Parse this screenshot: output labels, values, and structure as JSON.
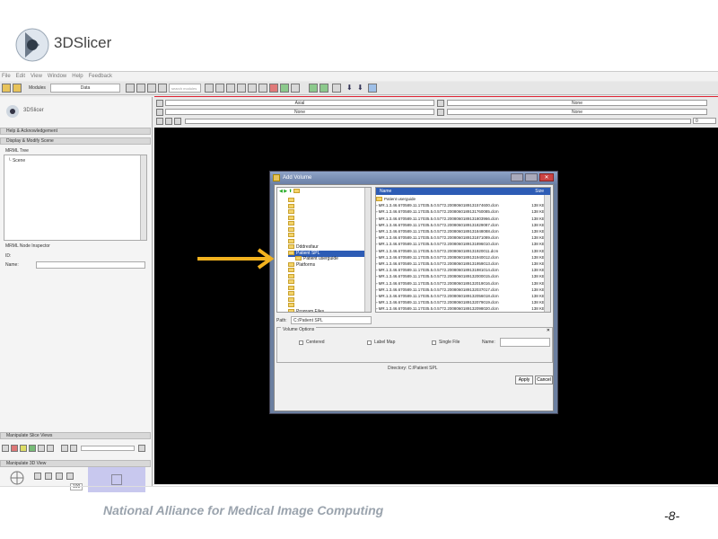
{
  "logo": {
    "text": "3DSlicer"
  },
  "menubar": {
    "items": [
      "File",
      "Edit",
      "View",
      "Window",
      "Help",
      "Feedback"
    ]
  },
  "toolbar": {
    "modules_label": "Modules",
    "modules_value": "Data",
    "search_placeholder": "search modules"
  },
  "left_panel": {
    "logo_text": "3DSlicer",
    "help_header": "Help & Acknowledgement",
    "display_header": "Display & Modify Scene",
    "mrml_tree_label": "MRML Tree",
    "scene_item": "Scene",
    "inspector_label": "MRML Node Inspector",
    "id_label": "ID:",
    "name_label": "Name:",
    "manipulate_slice_header": "Manipulate Slice Views",
    "manipulate_3d_header": "Manipulate 3D View",
    "zoom_value": "100"
  },
  "view_header": {
    "axial": "Axial",
    "none_left": "None",
    "none_right_1": "None",
    "none_right_2": "None",
    "slice_value": "0"
  },
  "dialog": {
    "title": "Add Volume",
    "tree": [
      "",
      "",
      "",
      "",
      "",
      "",
      "",
      "",
      "Dddresfaur",
      "Patient SPL",
      "Patient userguide",
      "Platforms",
      "",
      "",
      "",
      "",
      "",
      "",
      "",
      "Program Files"
    ],
    "selected_index": 9,
    "list_header_name": "Name",
    "list_header_size": "Size",
    "files": [
      {
        "name": "Patient userguide",
        "size": ""
      },
      {
        "name": "MR.1.3.46.670589.11.17035.5.0.5772.2008060189131574600.dcm",
        "size": "138 KB"
      },
      {
        "name": "MR.1.3.46.670589.11.17035.5.0.5772.2008060189131760085.dcm",
        "size": "138 KB"
      },
      {
        "name": "MR.1.3.46.670589.11.17035.5.0.5772.2008060189131803966.dcm",
        "size": "138 KB"
      },
      {
        "name": "MR.1.3.46.670589.11.17035.5.0.5772.2008060189131829087.dcm",
        "size": "138 KB"
      },
      {
        "name": "MR.1.3.46.670589.11.17035.5.0.5772.2008060189131848088.dcm",
        "size": "138 KB"
      },
      {
        "name": "MR.1.3.46.670589.11.17035.5.0.5772.2008060189131871089.dcm",
        "size": "138 KB"
      },
      {
        "name": "MR.1.3.46.670589.11.17035.5.0.5772.2008060189131896010.dcm",
        "size": "138 KB"
      },
      {
        "name": "MR.1.3.46.670589.11.17035.5.0.5772.2008060189131920011.dcm",
        "size": "138 KB"
      },
      {
        "name": "MR.1.3.46.670589.11.17035.5.0.5772.2008060189131940012.dcm",
        "size": "138 KB"
      },
      {
        "name": "MR.1.3.46.670589.11.17035.5.0.5772.2008060189131959013.dcm",
        "size": "138 KB"
      },
      {
        "name": "MR.1.3.46.670589.11.17035.5.0.5772.2008060189131981014.dcm",
        "size": "138 KB"
      },
      {
        "name": "MR.1.3.46.670589.11.17035.5.0.5772.2008060189132000015.dcm",
        "size": "138 KB"
      },
      {
        "name": "MR.1.3.46.670589.11.17035.5.0.5772.2008060189132019016.dcm",
        "size": "138 KB"
      },
      {
        "name": "MR.1.3.46.670589.11.17035.5.0.5772.2008060189132037017.dcm",
        "size": "138 KB"
      },
      {
        "name": "MR.1.3.46.670589.11.17035.5.0.5772.2008060189132056018.dcm",
        "size": "138 KB"
      },
      {
        "name": "MR.1.3.46.670589.11.17035.5.0.5772.2008060189132079019.dcm",
        "size": "138 KB"
      },
      {
        "name": "MR.1.3.46.670589.11.17035.5.0.5772.2008060189132098020.dcm",
        "size": "138 KB"
      }
    ],
    "path_label": "Path:",
    "path_value": "C:/Patient SPL",
    "volume_options_label": "Volume Options",
    "centered_label": "Centered",
    "label_map_label": "Label Map",
    "single_file_label": "Single File",
    "name_label": "Name:",
    "directory_label": "Directory: C:/Patient SPL",
    "apply_label": "Apply",
    "cancel_label": "Cancel"
  },
  "footer": {
    "text": "National Alliance for Medical Image Computing",
    "page": "-8-"
  },
  "colors": {
    "accent_red": "#d22233",
    "selection_blue": "#2d5cb5",
    "arrow": "#f2b21f"
  }
}
